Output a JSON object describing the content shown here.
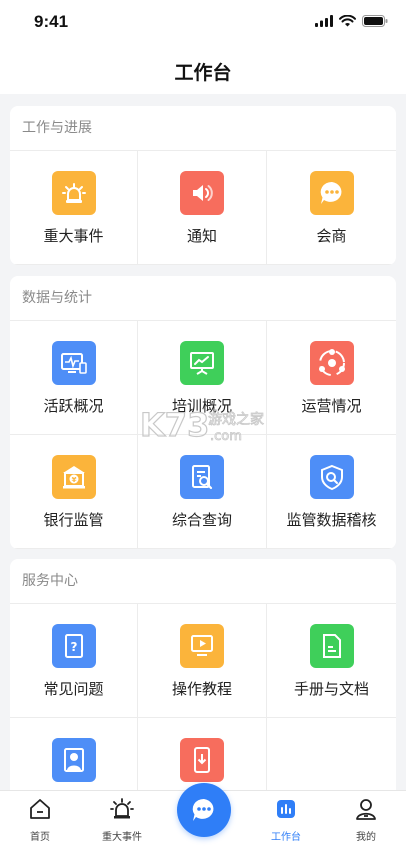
{
  "status_bar": {
    "time": "9:41"
  },
  "header": {
    "title": "工作台"
  },
  "sections": [
    {
      "title": "工作与进展",
      "items": [
        {
          "label": "重大事件",
          "icon": "alarm-light-icon",
          "color": "#fbb43b"
        },
        {
          "label": "通知",
          "icon": "speaker-icon",
          "color": "#f76d5d"
        },
        {
          "label": "会商",
          "icon": "chat-bubble-icon",
          "color": "#fbb43b"
        }
      ]
    },
    {
      "title": "数据与统计",
      "items": [
        {
          "label": "活跃概况",
          "icon": "monitor-pulse-icon",
          "color": "#4e8ef7"
        },
        {
          "label": "培训概况",
          "icon": "presentation-chart-icon",
          "color": "#3fcf5a"
        },
        {
          "label": "运营情况",
          "icon": "share-nodes-icon",
          "color": "#f76d5d"
        },
        {
          "label": "银行监管",
          "icon": "bank-yuan-icon",
          "color": "#fbb43b"
        },
        {
          "label": "综合查询",
          "icon": "document-search-icon",
          "color": "#4e8ef7"
        },
        {
          "label": "监管数据稽核",
          "icon": "shield-search-icon",
          "color": "#4e8ef7"
        }
      ]
    },
    {
      "title": "服务中心",
      "items": [
        {
          "label": "常见问题",
          "icon": "question-doc-icon",
          "color": "#4e8ef7"
        },
        {
          "label": "操作教程",
          "icon": "video-play-icon",
          "color": "#fbb43b"
        },
        {
          "label": "手册与文档",
          "icon": "document-icon",
          "color": "#3fcf5a"
        },
        {
          "label": "",
          "icon": "user-contact-icon",
          "color": "#4e8ef7"
        },
        {
          "label": "",
          "icon": "phone-download-icon",
          "color": "#f76d5d"
        },
        {
          "label": "",
          "icon": "",
          "color": ""
        }
      ]
    }
  ],
  "watermark": {
    "brand": "K73",
    "text_top": "游戏之家",
    "text_bottom": ".com"
  },
  "tab_bar": {
    "accent": "#2f7ef7",
    "tabs": [
      {
        "label": "首页",
        "icon": "home-icon",
        "active": false
      },
      {
        "label": "重大事件",
        "icon": "alarm-light-icon",
        "active": false
      },
      {
        "label": "",
        "icon": "chat-bubble-icon",
        "active": false
      },
      {
        "label": "工作台",
        "icon": "bar-chart-icon",
        "active": true
      },
      {
        "label": "我的",
        "icon": "person-icon",
        "active": false
      }
    ]
  }
}
